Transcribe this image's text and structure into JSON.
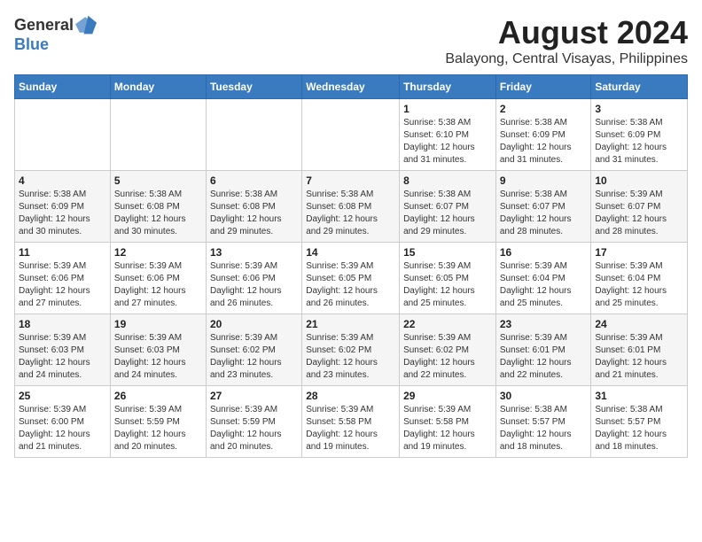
{
  "logo": {
    "general": "General",
    "blue": "Blue"
  },
  "title": {
    "month_year": "August 2024",
    "location": "Balayong, Central Visayas, Philippines"
  },
  "days_of_week": [
    "Sunday",
    "Monday",
    "Tuesday",
    "Wednesday",
    "Thursday",
    "Friday",
    "Saturday"
  ],
  "weeks": [
    [
      {
        "day": "",
        "info": ""
      },
      {
        "day": "",
        "info": ""
      },
      {
        "day": "",
        "info": ""
      },
      {
        "day": "",
        "info": ""
      },
      {
        "day": "1",
        "info": "Sunrise: 5:38 AM\nSunset: 6:10 PM\nDaylight: 12 hours\nand 31 minutes."
      },
      {
        "day": "2",
        "info": "Sunrise: 5:38 AM\nSunset: 6:09 PM\nDaylight: 12 hours\nand 31 minutes."
      },
      {
        "day": "3",
        "info": "Sunrise: 5:38 AM\nSunset: 6:09 PM\nDaylight: 12 hours\nand 31 minutes."
      }
    ],
    [
      {
        "day": "4",
        "info": "Sunrise: 5:38 AM\nSunset: 6:09 PM\nDaylight: 12 hours\nand 30 minutes."
      },
      {
        "day": "5",
        "info": "Sunrise: 5:38 AM\nSunset: 6:08 PM\nDaylight: 12 hours\nand 30 minutes."
      },
      {
        "day": "6",
        "info": "Sunrise: 5:38 AM\nSunset: 6:08 PM\nDaylight: 12 hours\nand 29 minutes."
      },
      {
        "day": "7",
        "info": "Sunrise: 5:38 AM\nSunset: 6:08 PM\nDaylight: 12 hours\nand 29 minutes."
      },
      {
        "day": "8",
        "info": "Sunrise: 5:38 AM\nSunset: 6:07 PM\nDaylight: 12 hours\nand 29 minutes."
      },
      {
        "day": "9",
        "info": "Sunrise: 5:38 AM\nSunset: 6:07 PM\nDaylight: 12 hours\nand 28 minutes."
      },
      {
        "day": "10",
        "info": "Sunrise: 5:39 AM\nSunset: 6:07 PM\nDaylight: 12 hours\nand 28 minutes."
      }
    ],
    [
      {
        "day": "11",
        "info": "Sunrise: 5:39 AM\nSunset: 6:06 PM\nDaylight: 12 hours\nand 27 minutes."
      },
      {
        "day": "12",
        "info": "Sunrise: 5:39 AM\nSunset: 6:06 PM\nDaylight: 12 hours\nand 27 minutes."
      },
      {
        "day": "13",
        "info": "Sunrise: 5:39 AM\nSunset: 6:06 PM\nDaylight: 12 hours\nand 26 minutes."
      },
      {
        "day": "14",
        "info": "Sunrise: 5:39 AM\nSunset: 6:05 PM\nDaylight: 12 hours\nand 26 minutes."
      },
      {
        "day": "15",
        "info": "Sunrise: 5:39 AM\nSunset: 6:05 PM\nDaylight: 12 hours\nand 25 minutes."
      },
      {
        "day": "16",
        "info": "Sunrise: 5:39 AM\nSunset: 6:04 PM\nDaylight: 12 hours\nand 25 minutes."
      },
      {
        "day": "17",
        "info": "Sunrise: 5:39 AM\nSunset: 6:04 PM\nDaylight: 12 hours\nand 25 minutes."
      }
    ],
    [
      {
        "day": "18",
        "info": "Sunrise: 5:39 AM\nSunset: 6:03 PM\nDaylight: 12 hours\nand 24 minutes."
      },
      {
        "day": "19",
        "info": "Sunrise: 5:39 AM\nSunset: 6:03 PM\nDaylight: 12 hours\nand 24 minutes."
      },
      {
        "day": "20",
        "info": "Sunrise: 5:39 AM\nSunset: 6:02 PM\nDaylight: 12 hours\nand 23 minutes."
      },
      {
        "day": "21",
        "info": "Sunrise: 5:39 AM\nSunset: 6:02 PM\nDaylight: 12 hours\nand 23 minutes."
      },
      {
        "day": "22",
        "info": "Sunrise: 5:39 AM\nSunset: 6:02 PM\nDaylight: 12 hours\nand 22 minutes."
      },
      {
        "day": "23",
        "info": "Sunrise: 5:39 AM\nSunset: 6:01 PM\nDaylight: 12 hours\nand 22 minutes."
      },
      {
        "day": "24",
        "info": "Sunrise: 5:39 AM\nSunset: 6:01 PM\nDaylight: 12 hours\nand 21 minutes."
      }
    ],
    [
      {
        "day": "25",
        "info": "Sunrise: 5:39 AM\nSunset: 6:00 PM\nDaylight: 12 hours\nand 21 minutes."
      },
      {
        "day": "26",
        "info": "Sunrise: 5:39 AM\nSunset: 5:59 PM\nDaylight: 12 hours\nand 20 minutes."
      },
      {
        "day": "27",
        "info": "Sunrise: 5:39 AM\nSunset: 5:59 PM\nDaylight: 12 hours\nand 20 minutes."
      },
      {
        "day": "28",
        "info": "Sunrise: 5:39 AM\nSunset: 5:58 PM\nDaylight: 12 hours\nand 19 minutes."
      },
      {
        "day": "29",
        "info": "Sunrise: 5:39 AM\nSunset: 5:58 PM\nDaylight: 12 hours\nand 19 minutes."
      },
      {
        "day": "30",
        "info": "Sunrise: 5:38 AM\nSunset: 5:57 PM\nDaylight: 12 hours\nand 18 minutes."
      },
      {
        "day": "31",
        "info": "Sunrise: 5:38 AM\nSunset: 5:57 PM\nDaylight: 12 hours\nand 18 minutes."
      }
    ]
  ]
}
